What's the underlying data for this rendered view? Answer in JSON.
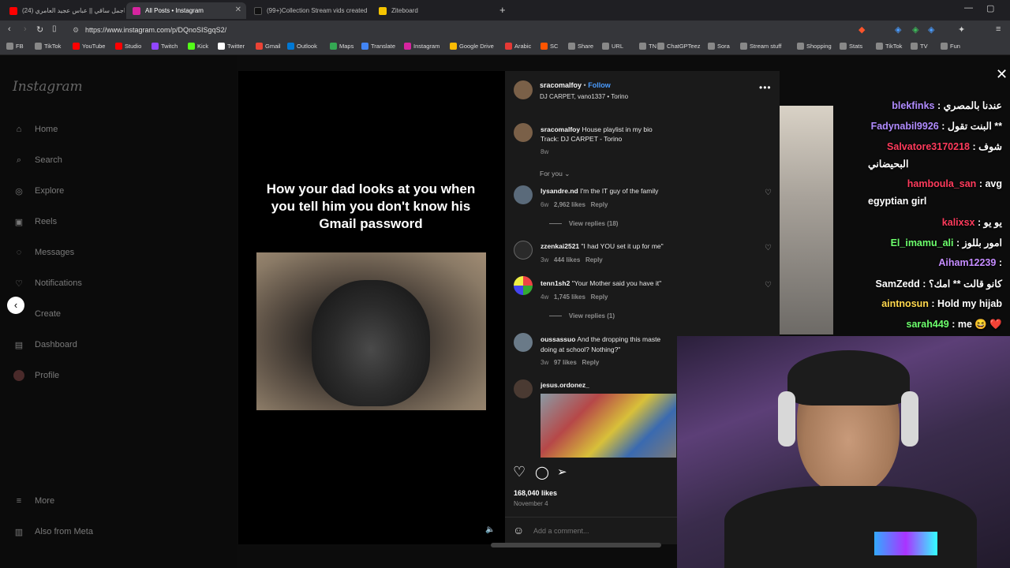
{
  "browser": {
    "tabs": [
      {
        "title": "(24) اجمل ساقي || عباس عجيد العامري",
        "active": false,
        "fav_color": "#ff0000"
      },
      {
        "title": "All Posts • Instagram",
        "active": true,
        "fav_color": "#d6249f"
      },
      {
        "title": "(99+)Collection Stream vids created",
        "active": false,
        "fav_color": "#111111"
      },
      {
        "title": "Ziteboard",
        "active": false,
        "fav_color": "#f5c400"
      }
    ],
    "new_tab_label": "+",
    "url": "https://www.instagram.com/p/DQnoSISgqS2/",
    "bookmarks": [
      {
        "label": "FB",
        "color": "#888"
      },
      {
        "label": "TikTok",
        "color": "#888"
      },
      {
        "label": "YouTube",
        "color": "#ff0000"
      },
      {
        "label": "Studio",
        "color": "#ff0000"
      },
      {
        "label": "Twitch",
        "color": "#9146ff"
      },
      {
        "label": "Kick",
        "color": "#53fc18"
      },
      {
        "label": "Twitter",
        "color": "#ffffff"
      },
      {
        "label": "Gmail",
        "color": "#ea4335"
      },
      {
        "label": "Outlook",
        "color": "#0078d4"
      },
      {
        "label": "Maps",
        "color": "#34a853"
      },
      {
        "label": "Translate",
        "color": "#4285f4"
      },
      {
        "label": "Instagram",
        "color": "#d6249f"
      },
      {
        "label": "Google Drive",
        "color": "#fbbc04"
      },
      {
        "label": "Arabic",
        "color": "#e53935"
      },
      {
        "label": "SC",
        "color": "#ff5500"
      },
      {
        "label": "Share",
        "color": "#888"
      },
      {
        "label": "URL",
        "color": "#888"
      },
      {
        "label": "TN",
        "color": "#888"
      },
      {
        "label": "ChatGPTeez",
        "color": "#888"
      },
      {
        "label": "Sora",
        "color": "#888"
      },
      {
        "label": "Stream stuff",
        "color": "#888"
      },
      {
        "label": "Shopping",
        "color": "#888"
      },
      {
        "label": "Stats",
        "color": "#888"
      },
      {
        "label": "TikTok",
        "color": "#888"
      },
      {
        "label": "TV",
        "color": "#888"
      },
      {
        "label": "Fun",
        "color": "#888"
      }
    ]
  },
  "sidebar": {
    "logo": "Instagram",
    "items": [
      {
        "label": "Home",
        "icon": "home-icon"
      },
      {
        "label": "Search",
        "icon": "search-icon"
      },
      {
        "label": "Explore",
        "icon": "compass-icon"
      },
      {
        "label": "Reels",
        "icon": "reels-icon"
      },
      {
        "label": "Messages",
        "icon": "messenger-icon"
      },
      {
        "label": "Notifications",
        "icon": "heart-icon"
      },
      {
        "label": "Create",
        "icon": "plus-square-icon"
      },
      {
        "label": "Dashboard",
        "icon": "dashboard-icon"
      },
      {
        "label": "Profile",
        "icon": "avatar-icon"
      }
    ],
    "more": "More",
    "also_from_meta": "Also from Meta"
  },
  "post": {
    "overlay_text": "How your dad looks at you when you tell him you don't know his Gmail password",
    "author": "sracomalfoy",
    "follow": "Follow",
    "separator": "•",
    "audio": "DJ CARPET, vano1337 • Torino",
    "caption_author": "sracomalfoy",
    "caption_text": "House playlist in my bio",
    "caption_track": "Track: DJ CARPET - Torino",
    "caption_time": "8w",
    "for_you": "For you",
    "comments": [
      {
        "user": "lysandre.nd",
        "text": "I'm the IT guy of the family",
        "time": "6w",
        "likes": "2,962 likes",
        "reply": "Reply",
        "view_replies": "View replies (18)"
      },
      {
        "user": "zzenkai2521",
        "text": "\"I had YOU set it up for me\"",
        "time": "3w",
        "likes": "444 likes",
        "reply": "Reply"
      },
      {
        "user": "tenn1sh2",
        "text": "\"Your Mother said you have it\"",
        "time": "4w",
        "likes": "1,745 likes",
        "reply": "Reply",
        "view_replies": "View replies (1)"
      },
      {
        "user": "oussassuo",
        "text": "And the dropping this maste",
        "text2": "doing at school? Nothing?\"",
        "time": "3w",
        "likes": "97 likes",
        "reply": "Reply"
      },
      {
        "user": "jesus.ordonez_",
        "text": ""
      }
    ],
    "likes": "168,040 likes",
    "date": "November 4",
    "add_comment": "Add a comment..."
  },
  "chat": [
    {
      "user": "blekfinks",
      "msg": ": عندنا بالمصري",
      "color": "#b18cff"
    },
    {
      "user": "Fadynabil9926",
      "msg": ": البنت تقول **",
      "color": "#b18cff"
    },
    {
      "user": "Salvatore3170218",
      "msg": ": شوف",
      "msg2": "البحيضاني",
      "color": "#ff3b5c"
    },
    {
      "user": "hamboula_san",
      "msg": ": avg",
      "msg2": "egyptian girl",
      "color": "#ff3b5c"
    },
    {
      "user": "kalixsx",
      "msg": ": يو يو",
      "color": "#ff3b5c"
    },
    {
      "user": "El_imamu_ali",
      "msg": ": امور بللوز",
      "color": "#6dff6d"
    },
    {
      "user": "Aiham12239",
      "msg": ":",
      "color": "#c58cff"
    },
    {
      "user": "SamZedd",
      "msg": ": كانو قالت ** امك؟",
      "color": "#ffffff"
    },
    {
      "user": "aintnosun",
      "msg": ": Hold my hijab",
      "color": "#ffd84d"
    },
    {
      "user": "sarah449",
      "msg": ": me 😆 ❤️",
      "color": "#6dff6d"
    }
  ]
}
